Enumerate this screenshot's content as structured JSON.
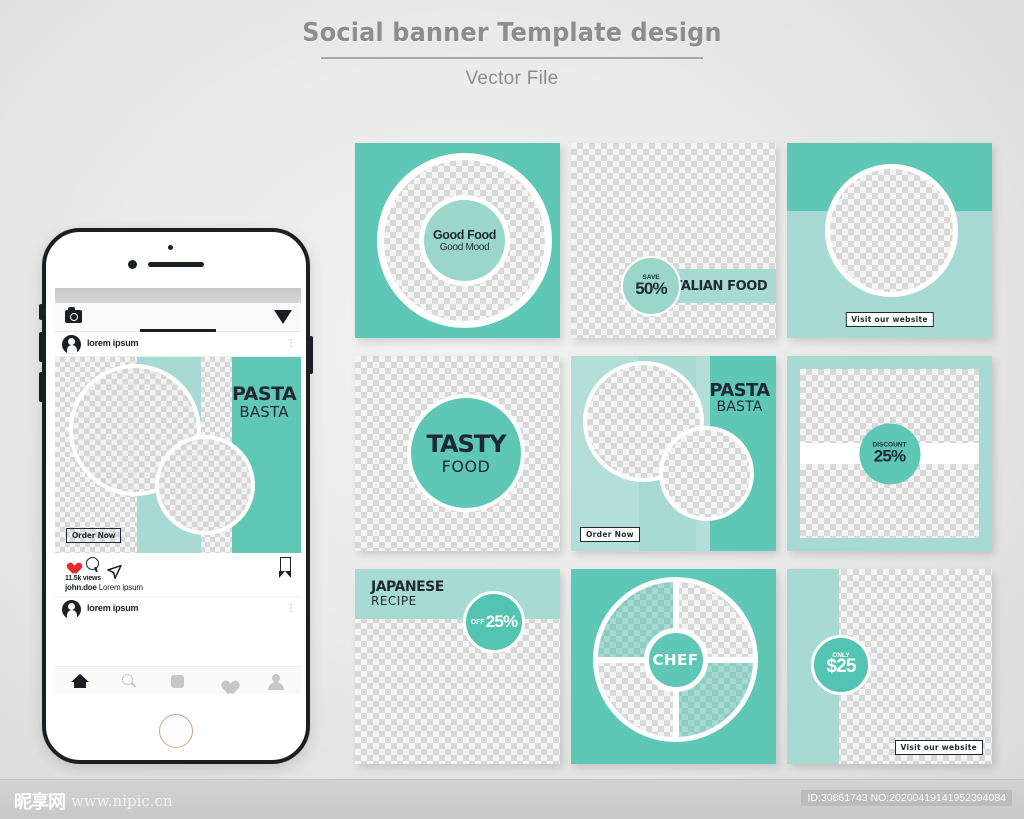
{
  "header": {
    "title": "Social banner Template design",
    "subtitle": "Vector File"
  },
  "phone": {
    "app_bar": {
      "camera_icon": "camera-icon",
      "send_icon": "send-icon"
    },
    "post": {
      "username": "lorem ipsum",
      "menu_icon": "more-options-icon",
      "design": {
        "headline": "PASTA",
        "subheadline": "BASTA",
        "cta": "Order Now"
      },
      "actions": {
        "like_icon": "heart-icon",
        "comment_icon": "comment-icon",
        "share_icon": "send-icon",
        "save_icon": "bookmark-icon"
      },
      "views": "11.5k views",
      "caption_user": "john.doe",
      "caption_text": "Lorem ipsum",
      "next_post_username": "lorem ipsum"
    },
    "tabbar": [
      {
        "name": "home",
        "icon": "home-icon",
        "active": true
      },
      {
        "name": "search",
        "icon": "search-icon",
        "active": false
      },
      {
        "name": "add",
        "icon": "add-square-icon",
        "active": false
      },
      {
        "name": "activity",
        "icon": "heart-icon",
        "active": false
      },
      {
        "name": "profile",
        "icon": "person-icon",
        "active": false
      }
    ]
  },
  "tiles": [
    {
      "id": "good-food",
      "line1": "Good Food",
      "line2": "Good Mood"
    },
    {
      "id": "italian-food",
      "badge_small": "SAVE",
      "badge_big": "50%",
      "band_text": "ITALIAN FOOD"
    },
    {
      "id": "visit-website-circle",
      "cta": "Visit our website"
    },
    {
      "id": "tasty-food",
      "line1": "TASTY",
      "line2": "FOOD"
    },
    {
      "id": "pasta-basta",
      "headline": "PASTA",
      "subheadline": "BASTA",
      "cta": "Order Now"
    },
    {
      "id": "discount-25",
      "badge_small": "DISCOUNT",
      "badge_big": "25%"
    },
    {
      "id": "japanese-recipe",
      "line1": "JAPANESE",
      "line2": "RECIPE",
      "badge_small": "OFF",
      "badge_big": "25%"
    },
    {
      "id": "chef-wheel",
      "center_label": "CHEF"
    },
    {
      "id": "only-25",
      "badge_small": "ONLY",
      "badge_big": "$25",
      "cta": "Visit our website"
    }
  ],
  "footer": {
    "brand_cn": "昵享网",
    "brand_url": "www.nipic.cn",
    "id_text": "ID:30861743 NO:20200419141952394084"
  },
  "colors": {
    "teal": "#5fc7b5",
    "teal_mid": "#9ad7ca",
    "teal_light": "#a7dad2",
    "teal_pale": "#b4dfd8",
    "ink": "#1f2933",
    "heart_red": "#e8282c"
  }
}
